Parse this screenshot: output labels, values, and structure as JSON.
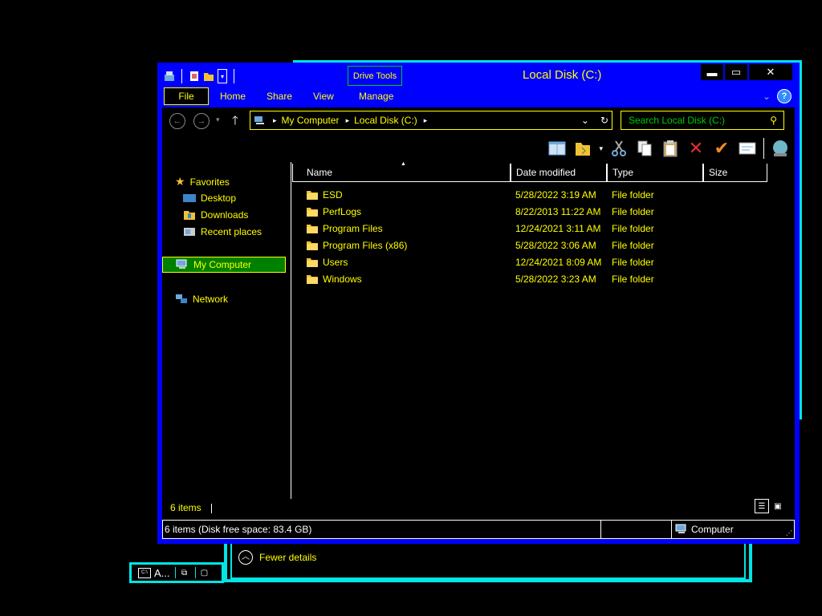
{
  "window": {
    "title": "Local Disk (C:)",
    "contextual_tab": "Drive Tools",
    "minimize_glyph": "▬",
    "maximize_glyph": "▭",
    "close_glyph": "✕"
  },
  "ribbon": {
    "tabs": [
      "File",
      "Home",
      "Share",
      "View",
      "Manage"
    ],
    "help_glyph": "?",
    "expand_glyph": "⌄"
  },
  "address": {
    "crumbs": [
      "My Computer",
      "Local Disk (C:)"
    ],
    "separator": "▸"
  },
  "search": {
    "placeholder": "Search Local Disk (C:)"
  },
  "nav": {
    "favorites": "Favorites",
    "favorites_items": [
      "Desktop",
      "Downloads",
      "Recent places"
    ],
    "computer": "My Computer",
    "network": "Network"
  },
  "columns": [
    "Name",
    "Date modified",
    "Type",
    "Size"
  ],
  "files": [
    {
      "name": "ESD",
      "date": "5/28/2022 3:19 AM",
      "type": "File folder",
      "size": ""
    },
    {
      "name": "PerfLogs",
      "date": "8/22/2013 11:22 AM",
      "type": "File folder",
      "size": ""
    },
    {
      "name": "Program Files",
      "date": "12/24/2021 3:11 AM",
      "type": "File folder",
      "size": ""
    },
    {
      "name": "Program Files (x86)",
      "date": "5/28/2022 3:06 AM",
      "type": "File folder",
      "size": ""
    },
    {
      "name": "Users",
      "date": "12/24/2021 8:09 AM",
      "type": "File folder",
      "size": ""
    },
    {
      "name": "Windows",
      "date": "5/28/2022 3:23 AM",
      "type": "File folder",
      "size": ""
    }
  ],
  "status": {
    "item_count": "6 items",
    "bar_text": "6 items (Disk free space: 83.4 GB)",
    "location": "Computer"
  },
  "details_dialog": {
    "fewer_details": "Fewer details"
  },
  "taskbar": {
    "label": "A..."
  },
  "colors": {
    "window_frame": "#0000ff",
    "text": "#ffff00",
    "selection": "#008000",
    "accent_cyan": "#00e5e5"
  }
}
